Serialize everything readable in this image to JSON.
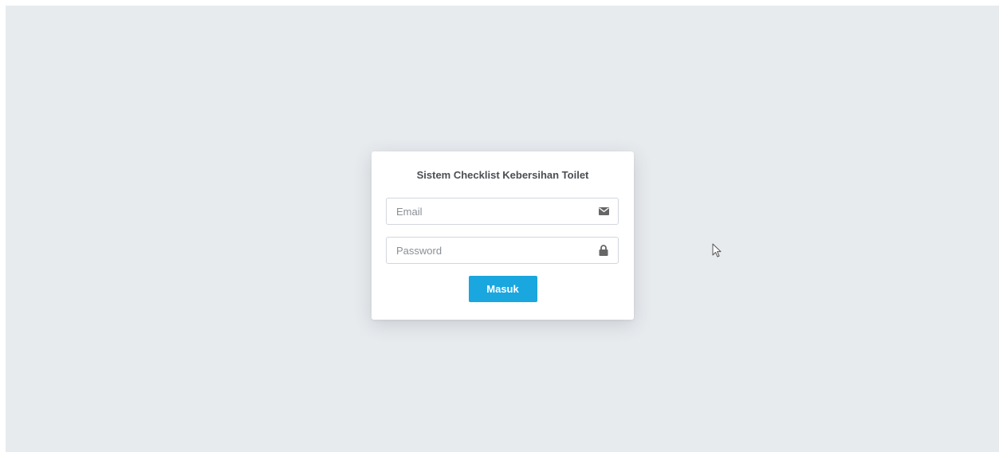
{
  "login": {
    "title": "Sistem Checklist Kebersihan Toilet",
    "email_placeholder": "Email",
    "email_value": "",
    "email_icon": "envelope-icon",
    "password_placeholder": "Password",
    "password_value": "",
    "password_icon": "lock-icon",
    "submit_label": "Masuk"
  },
  "colors": {
    "background": "#e8ebee",
    "card": "#ffffff",
    "button": "#1aa6de",
    "icon": "#666666",
    "title": "#4a4f55"
  }
}
